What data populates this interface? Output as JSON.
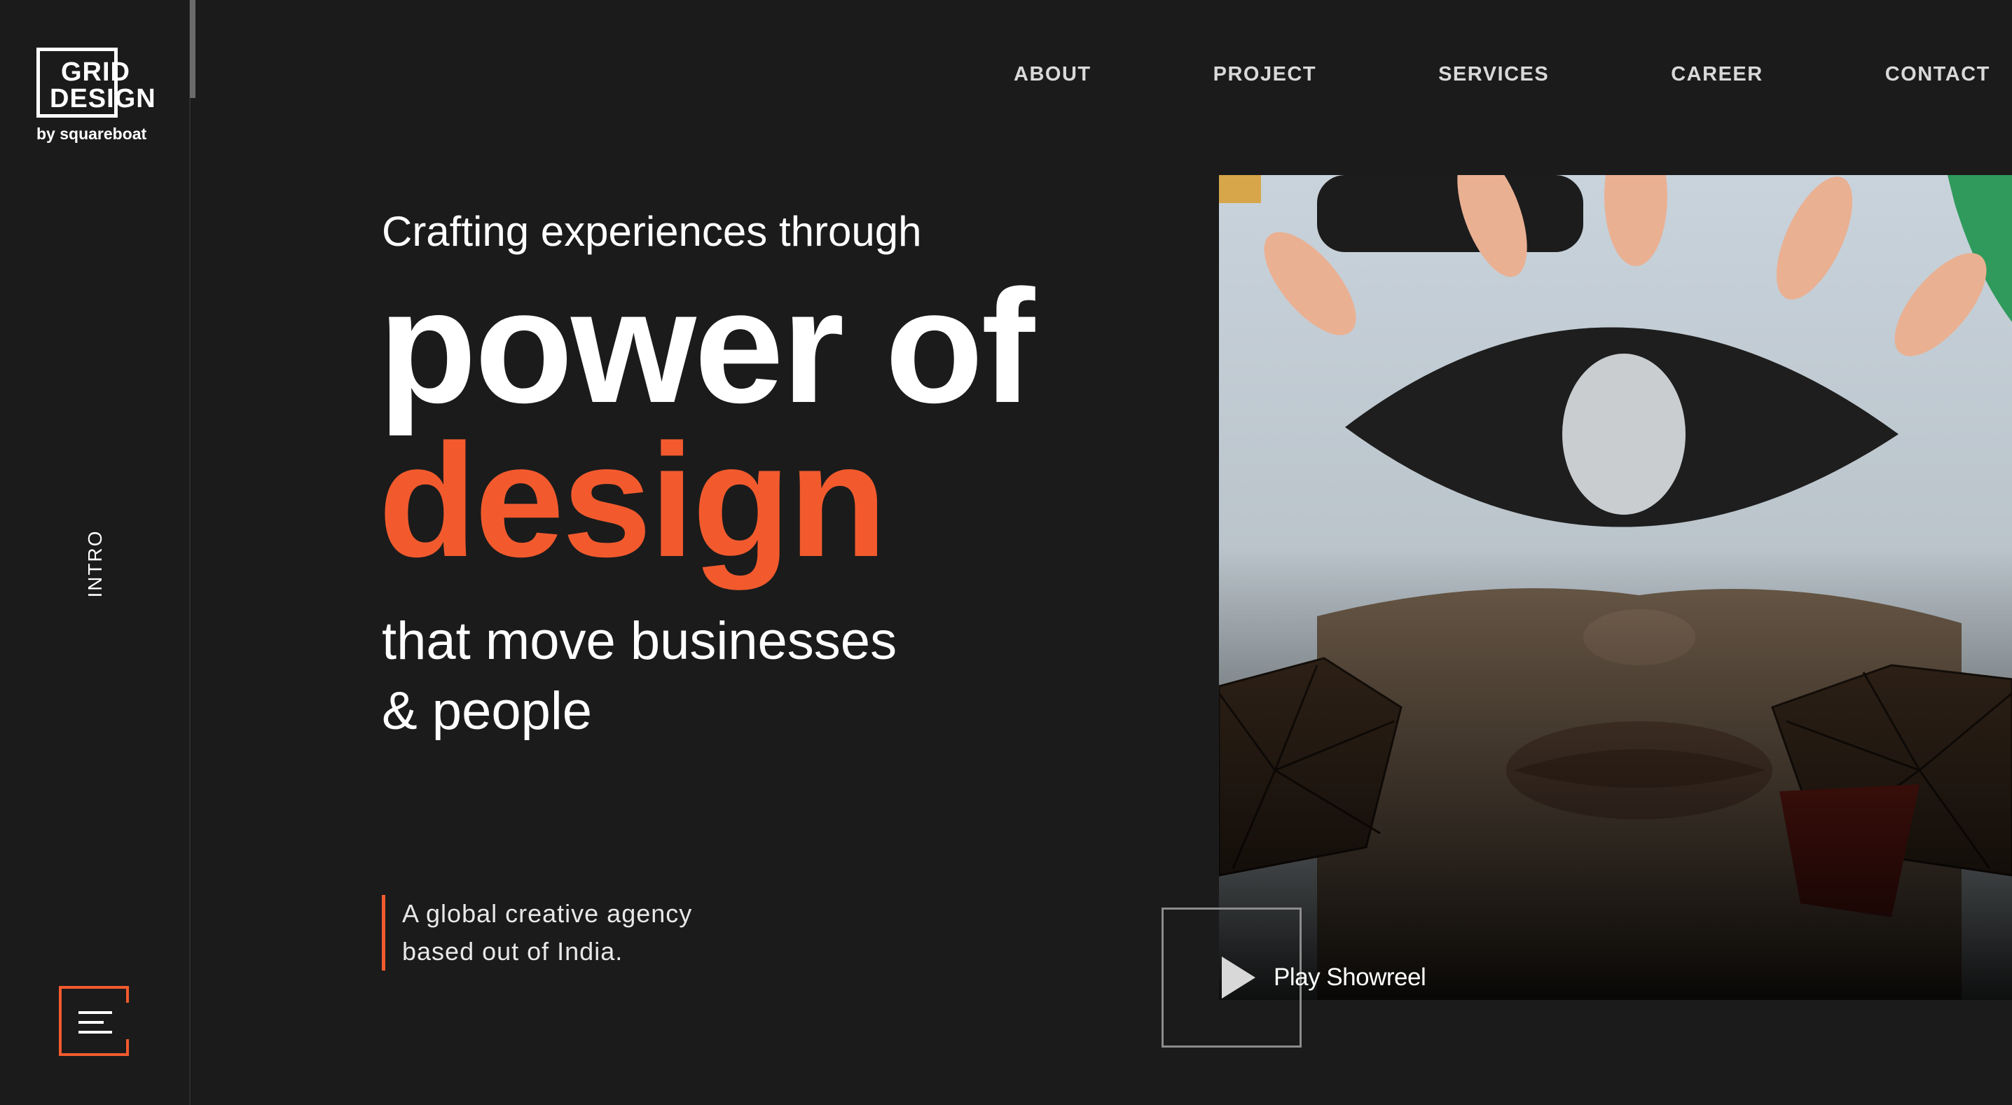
{
  "brand": {
    "logo_line1": "GRID",
    "logo_line2": "DESIGN",
    "logo_sub": "by squareboat"
  },
  "sidebar": {
    "section_label": "INTRO"
  },
  "nav": {
    "items": [
      {
        "label": "ABOUT"
      },
      {
        "label": "PROJECT"
      },
      {
        "label": "SERVICES"
      },
      {
        "label": "CAREER"
      },
      {
        "label": "CONTACT"
      }
    ]
  },
  "hero": {
    "intro": "Crafting experiences through",
    "main": "power of",
    "accent": "design",
    "sub_line1": "that move businesses",
    "sub_line2": "& people"
  },
  "tagline": {
    "line1": "A global creative agency",
    "line2": "based out of India."
  },
  "showreel": {
    "label": "Play Showreel"
  },
  "icons": {
    "menu": "hamburger-menu-icon",
    "play": "play-icon"
  },
  "colors": {
    "background": "#1b1b1b",
    "accent": "#f25a2e",
    "text": "#ffffff"
  }
}
